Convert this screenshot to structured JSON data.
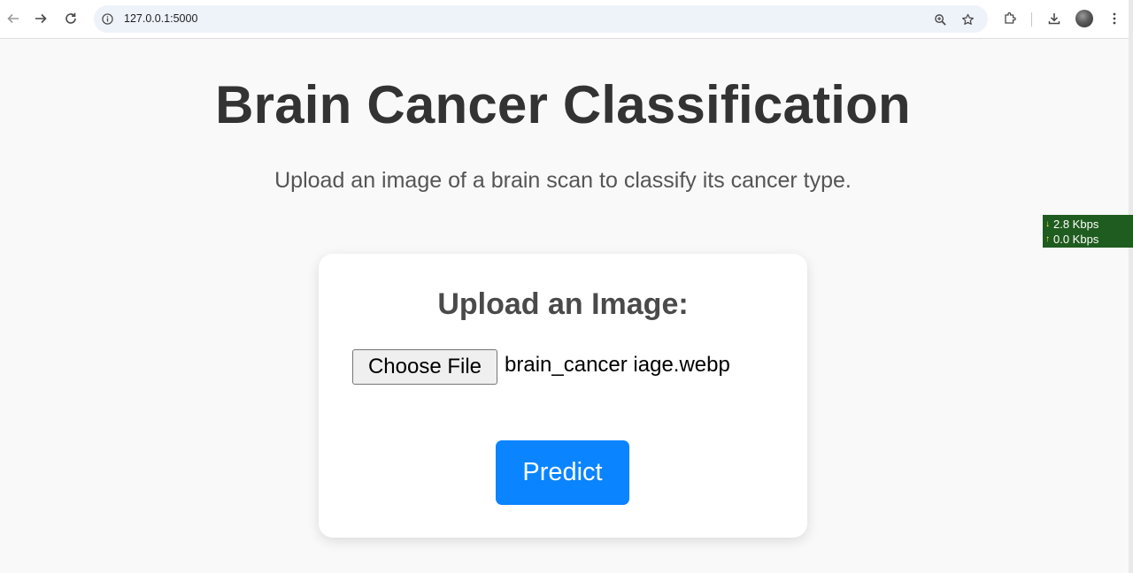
{
  "browser": {
    "url": "127.0.0.1:5000"
  },
  "page": {
    "title": "Brain Cancer Classification",
    "subtitle": "Upload an image of a brain scan to classify its cancer type."
  },
  "upload_card": {
    "heading": "Upload an Image:",
    "choose_file_label": "Choose File",
    "selected_file": "brain_cancer iage.webp",
    "predict_label": "Predict"
  },
  "network_widget": {
    "download": "2.8 Kbps",
    "upload": "0.0 Kbps"
  },
  "colors": {
    "accent": "#0a84ff",
    "widget_bg": "#1f5c1f"
  }
}
